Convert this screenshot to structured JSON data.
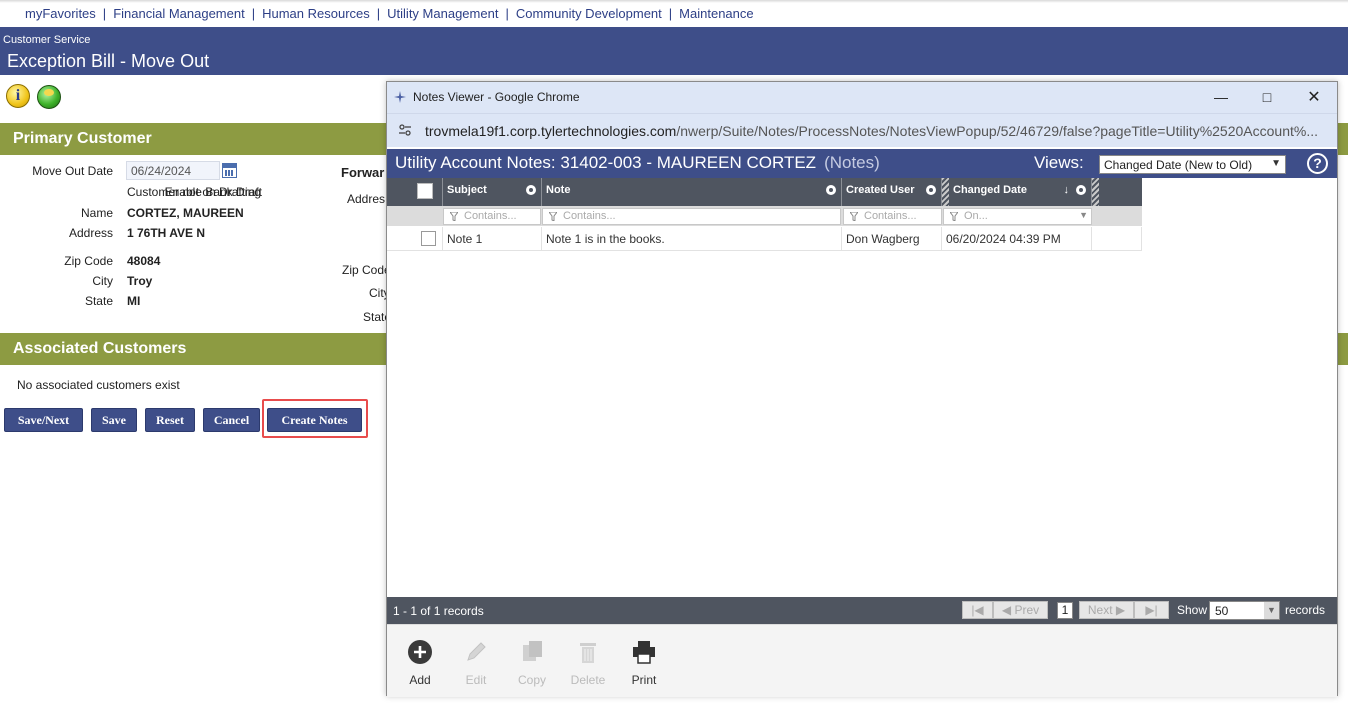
{
  "nav": {
    "items": [
      "myFavorites",
      "Financial Management",
      "Human Resources",
      "Utility Management",
      "Community Development",
      "Maintenance"
    ]
  },
  "header": {
    "subtitle": "Customer Service",
    "title": "Exception Bill - Move Out"
  },
  "primary": {
    "heading": "Primary Customer",
    "move_out_label": "Move Out Date",
    "move_out_value": "06/24/2024",
    "bank_label": "Enable Bank Draft",
    "bank_value": "Customer not on Drafting",
    "name_label": "Name",
    "name_value": "CORTEZ, MAUREEN",
    "address_label": "Address",
    "address_value": "1 76TH AVE N",
    "zip_label": "Zip Code",
    "zip_value": "48084",
    "city_label": "City",
    "city_value": "Troy",
    "state_label": "State",
    "state_value": "MI",
    "fwd_heading": "Forwar",
    "fwd_address": "Addres",
    "fwd_zip": "Zip Code",
    "fwd_city": "City",
    "fwd_state": "State"
  },
  "associated": {
    "heading": "Associated Customers",
    "empty_text": "No associated customers exist"
  },
  "buttons": {
    "save_next": "Save/Next",
    "save": "Save",
    "reset": "Reset",
    "cancel": "Cancel",
    "create_notes": "Create Notes"
  },
  "popup": {
    "window_title": "Notes Viewer - Google Chrome",
    "url_host": "trovmela19f1.corp.tylertechnologies.com",
    "url_path": "/nwerp/Suite/Notes/ProcessNotes/NotesViewPopup/52/46729/false?pageTitle=Utility%2520Account%...",
    "notes_title": "Utility Account Notes: 31402-003 - MAUREEN CORTEZ",
    "notes_suffix": "(Notes)",
    "views_label": "Views:",
    "views_selected": "Changed Date (New to Old)",
    "help": "?",
    "columns": {
      "subject": "Subject",
      "note": "Note",
      "created_user": "Created User",
      "changed_date": "Changed Date"
    },
    "filters": {
      "subject": "Contains...",
      "note": "Contains...",
      "created_user": "Contains...",
      "changed_date": "On..."
    },
    "rows": [
      {
        "subject": "Note 1",
        "note": "Note 1 is in the books.",
        "created_user": "Don Wagberg",
        "changed_date": "06/20/2024 04:39 PM"
      }
    ],
    "pager": {
      "count": "1 - 1 of 1 records",
      "prev": "Prev",
      "next": "Next",
      "page": "1",
      "show_label": "Show",
      "show_value": "50",
      "records_label": "records"
    },
    "actions": {
      "add": "Add",
      "edit": "Edit",
      "copy": "Copy",
      "delete": "Delete",
      "print": "Print"
    }
  },
  "colors": {
    "header_blue": "#3e4e89",
    "section_olive": "#8d9b42",
    "grid_head": "#4f5560",
    "highlight": "#e84c4c"
  }
}
